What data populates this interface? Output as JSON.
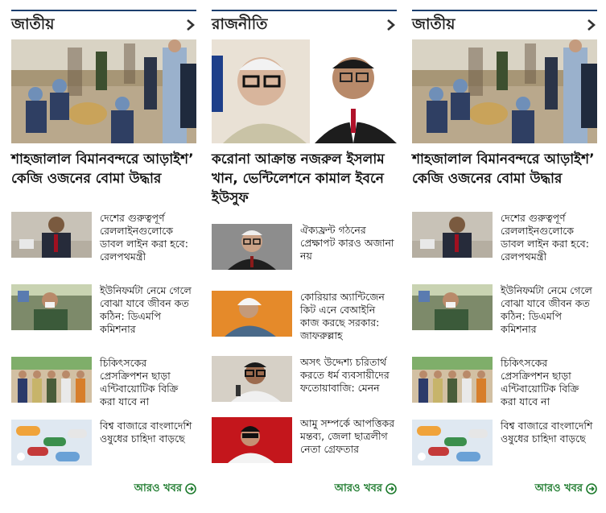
{
  "columns": [
    {
      "section_title": "জাতীয়",
      "lead": {
        "image_icon": "bomb-disposal-photo",
        "title": "শাহজালাল বিমানবন্দরে আড়াইশ’ কেজি ওজনের বোমা উদ্ধার"
      },
      "items": [
        {
          "image_icon": "minister-photo",
          "title": "দেশের গুরুত্বপূর্ণ রেললাইনগুলোকে ডাবল লাইন করা হবে: রেলপথমন্ত্রী"
        },
        {
          "image_icon": "police-officer-photo",
          "title": "ইউনিফর্মটা নেমে গেলে বোঝা যাবে জীবন কত কঠিন: ডিএমপি কমিশনার"
        },
        {
          "image_icon": "group-photo",
          "title": "চিকিৎসকের প্রেসক্রিপশন ছাড়া এন্টিবায়োটিক বিক্রি করা যাবে না"
        },
        {
          "image_icon": "medicine-photo",
          "title": "বিশ্ব বাজারে বাংলাদেশি ওষুধের চাহিদা বাড়ছে"
        }
      ],
      "more_label": "আরও খবর"
    },
    {
      "section_title": "রাজনীতি",
      "lead": {
        "image_icon": "two-politicians-photo",
        "title": "করোনা আক্রান্ত নজরুল ইসলাম খান, ভেন্টিলেশনে কামাল ইবনে ইউসুফ"
      },
      "items": [
        {
          "image_icon": "politician-photo",
          "title": "ঐক্যফ্রন্ট গঠনের প্রেক্ষাপট কারও অজানা নয়"
        },
        {
          "image_icon": "elder-man-photo",
          "title": "কোরিয়ার অ্যান্টিজেন কিট এনে বেআইনি কাজ করছে সরকার: জাফরুল্লাহ"
        },
        {
          "image_icon": "speaker-photo",
          "title": "অসৎ উদ্দেশ্য চরিতার্থ করতে ধর্ম ব্যবসায়ীদের ফতোয়াবাজি: মেনন"
        },
        {
          "image_icon": "young-man-photo",
          "title": "আমু সম্পর্কে আপত্তিকর মন্তব্য, জেলা ছাত্রলীগ নেতা গ্রেফতার"
        }
      ],
      "more_label": "আরও খবর"
    },
    {
      "section_title": "জাতীয়",
      "lead": {
        "image_icon": "bomb-disposal-photo",
        "title": "শাহজালাল বিমানবন্দরে আড়াইশ’ কেজি ওজনের বোমা উদ্ধার"
      },
      "items": [
        {
          "image_icon": "minister-photo",
          "title": "দেশের গুরুত্বপূর্ণ রেললাইনগুলোকে ডাবল লাইন করা হবে: রেলপথমন্ত্রী"
        },
        {
          "image_icon": "police-officer-photo",
          "title": "ইউনিফর্মটা নেমে গেলে বোঝা যাবে জীবন কত কঠিন: ডিএমপি কমিশনার"
        },
        {
          "image_icon": "group-photo",
          "title": "চিকিৎসকের প্রেসক্রিপশন ছাড়া এন্টিবায়োটিক বিক্রি করা যাবে না"
        },
        {
          "image_icon": "medicine-photo",
          "title": "বিশ্ব বাজারে বাংলাদেশি ওষুধের চাহিদা বাড়ছে"
        }
      ],
      "more_label": "আরও খবর"
    }
  ],
  "colors": {
    "section_rule": "#1c3f6e",
    "more_link": "#1e7b2e",
    "arrow": "#333333"
  }
}
